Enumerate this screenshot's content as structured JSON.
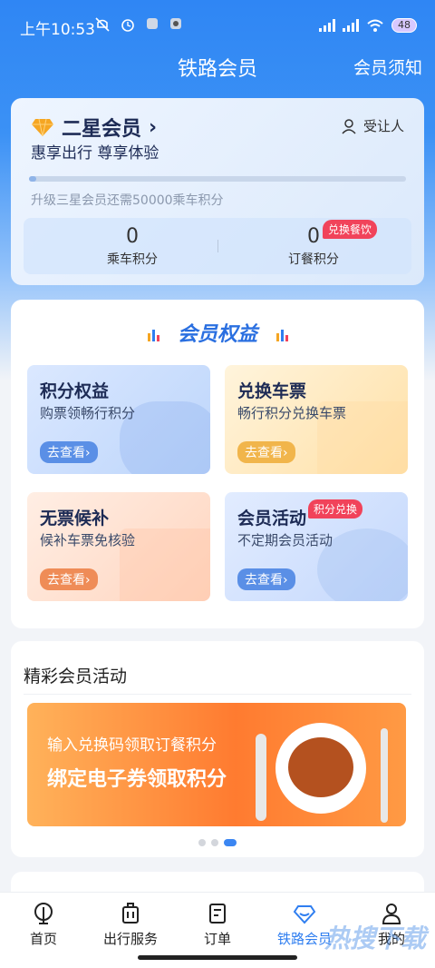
{
  "status_bar": {
    "time": "上午10:53",
    "battery": "48"
  },
  "header": {
    "title": "铁路会员",
    "notice": "会员须知"
  },
  "member": {
    "level": "二星会员",
    "chevron": "›",
    "slogan": "惠享出行 尊享体验",
    "transfer": "受让人",
    "progress": 0.02,
    "upgrade_text": "升级三星会员还需50000乘车积分",
    "ride_points": {
      "value": "0",
      "label": "乘车积分"
    },
    "meal_points": {
      "value": "0",
      "label": "订餐积分",
      "tag": "兑换餐饮"
    }
  },
  "benefits": {
    "title": "会员权益",
    "tiles": [
      {
        "title": "积分权益",
        "desc": "购票领畅行积分",
        "go": "去查看›"
      },
      {
        "title": "兑换车票",
        "desc": "畅行积分兑换车票",
        "go": "去查看›"
      },
      {
        "title": "无票候补",
        "desc": "候补车票免核验",
        "go": "去查看›"
      },
      {
        "title": "会员活动",
        "desc": "不定期会员活动",
        "go": "去查看›",
        "tag": "积分兑换"
      }
    ]
  },
  "activities": {
    "title": "精彩会员活动",
    "banner": {
      "line1": "输入兑换码领取订餐积分",
      "line2": "绑定电子券领取积分"
    },
    "carousel_active": 3,
    "carousel_count": 3
  },
  "tabbar": {
    "items": [
      {
        "label": "首页",
        "icon": "home-icon"
      },
      {
        "label": "出行服务",
        "icon": "luggage-icon"
      },
      {
        "label": "订单",
        "icon": "order-icon"
      },
      {
        "label": "铁路会员",
        "icon": "diamond-icon",
        "active": true
      },
      {
        "label": "我的",
        "icon": "person-icon"
      }
    ]
  },
  "watermark": "热搜下载",
  "colors": {
    "primary": "#2f7ef0",
    "accent_red": "#f1435a",
    "member_gold": "#f5a623"
  }
}
